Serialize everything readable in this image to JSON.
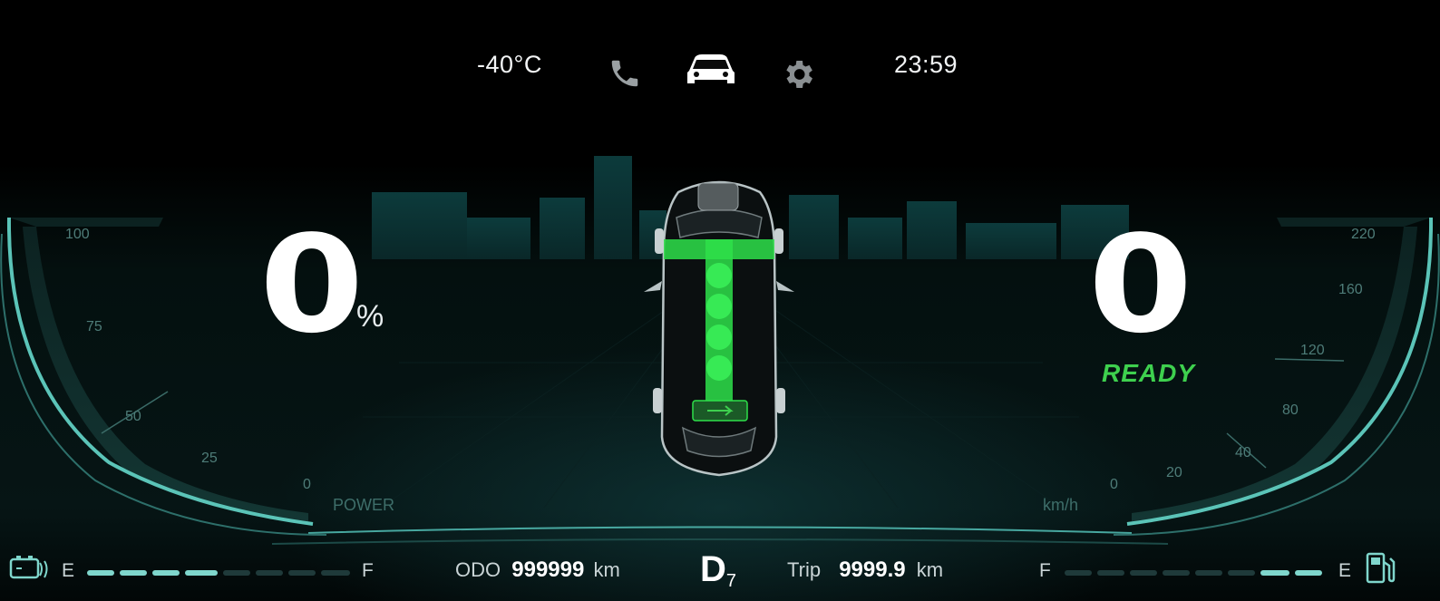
{
  "status_bar": {
    "temperature": "-40°C",
    "time": "23:59",
    "icons": [
      "phone-icon",
      "car-icon",
      "settings-gear-icon"
    ]
  },
  "battery": {
    "value": "0",
    "unit": "%",
    "gauge_label": "POWER",
    "ticks": [
      "100",
      "75",
      "50",
      "25",
      "0"
    ]
  },
  "speed": {
    "value": "0",
    "status": "READY",
    "gauge_label": "km/h",
    "ticks": [
      "220",
      "160",
      "120",
      "80",
      "40",
      "20",
      "0"
    ]
  },
  "bottom_bar": {
    "left_gauge": {
      "empty_label": "E",
      "full_label": "F",
      "level_segments_on": 4,
      "level_segments_total": 8,
      "icon": "battery-icon"
    },
    "odo_label": "ODO",
    "odo_value": "999999",
    "odo_unit": "km",
    "gear_letter": "D",
    "gear_number": "7",
    "trip_label": "Trip",
    "trip_value": "9999.9",
    "trip_unit": "km",
    "right_gauge": {
      "full_label": "F",
      "empty_label": "E",
      "level_segments_on": 2,
      "level_segments_total": 8,
      "icon": "fuel-pump-icon"
    }
  },
  "colors": {
    "accent_teal": "#7fd6cc",
    "ready_green": "#3ed04e",
    "power_flow_green": "#2ee04a"
  }
}
